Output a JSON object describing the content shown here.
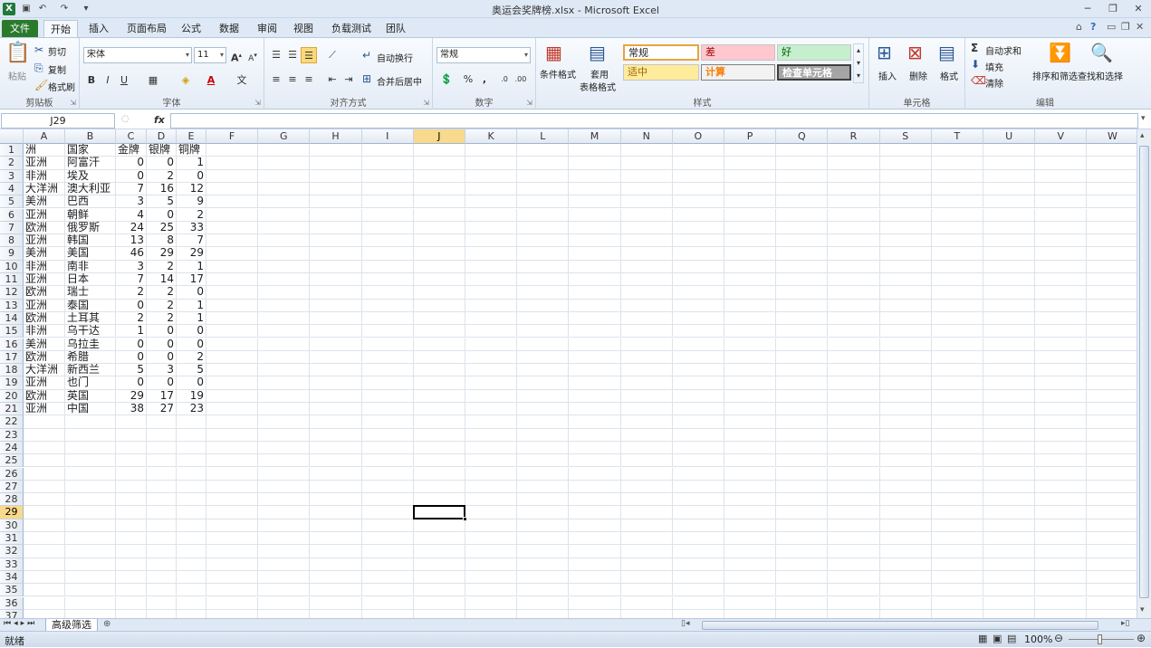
{
  "window": {
    "title": "奥运会奖牌榜.xlsx - Microsoft Excel"
  },
  "tabs": [
    "文件",
    "开始",
    "插入",
    "页面布局",
    "公式",
    "数据",
    "审阅",
    "视图",
    "负载测试",
    "团队"
  ],
  "ribbon": {
    "clipboard": {
      "paste": "粘贴",
      "cut": "剪切",
      "copy": "复制",
      "format_painter": "格式刷",
      "label": "剪贴板"
    },
    "font": {
      "name": "宋体",
      "size": "11",
      "label": "字体"
    },
    "alignment": {
      "wrap": "自动换行",
      "merge": "合并后居中",
      "label": "对齐方式"
    },
    "number": {
      "format": "常规",
      "label": "数字"
    },
    "styles": {
      "conditional": "条件格式",
      "table_l1": "套用",
      "table_l2": "表格格式",
      "normal": "常规",
      "bad": "差",
      "good": "好",
      "neutral": "适中",
      "calc": "计算",
      "check": "检查单元格",
      "label": "样式"
    },
    "cells": {
      "insert": "插入",
      "delete": "删除",
      "format": "格式",
      "label": "单元格"
    },
    "editing": {
      "autosum": "自动求和",
      "fill": "填充",
      "clear": "清除",
      "sort": "排序和筛选",
      "find": "查找和选择",
      "label": "编辑"
    }
  },
  "formula_bar": {
    "name_box": "J29",
    "fx": "fx",
    "formula": ""
  },
  "columns": [
    "A",
    "B",
    "C",
    "D",
    "E",
    "F",
    "G",
    "H",
    "I",
    "J",
    "K",
    "L",
    "M",
    "N",
    "O",
    "P",
    "Q",
    "R",
    "S",
    "T",
    "U",
    "V",
    "W"
  ],
  "selected_column": "J",
  "selected_row": 29,
  "row_count": 37,
  "sheet": {
    "headers": [
      "洲",
      "国家",
      "金牌",
      "银牌",
      "铜牌"
    ],
    "rows": [
      [
        "亚洲",
        "阿富汗",
        "0",
        "0",
        "1"
      ],
      [
        "非洲",
        "埃及",
        "0",
        "2",
        "0"
      ],
      [
        "大洋洲",
        "澳大利亚",
        "7",
        "16",
        "12"
      ],
      [
        "美洲",
        "巴西",
        "3",
        "5",
        "9"
      ],
      [
        "亚洲",
        "朝鲜",
        "4",
        "0",
        "2"
      ],
      [
        "欧洲",
        "俄罗斯",
        "24",
        "25",
        "33"
      ],
      [
        "亚洲",
        "韩国",
        "13",
        "8",
        "7"
      ],
      [
        "美洲",
        "美国",
        "46",
        "29",
        "29"
      ],
      [
        "非洲",
        "南非",
        "3",
        "2",
        "1"
      ],
      [
        "亚洲",
        "日本",
        "7",
        "14",
        "17"
      ],
      [
        "欧洲",
        "瑞士",
        "2",
        "2",
        "0"
      ],
      [
        "亚洲",
        "泰国",
        "0",
        "2",
        "1"
      ],
      [
        "欧洲",
        "土耳其",
        "2",
        "2",
        "1"
      ],
      [
        "非洲",
        "乌干达",
        "1",
        "0",
        "0"
      ],
      [
        "美洲",
        "乌拉圭",
        "0",
        "0",
        "0"
      ],
      [
        "欧洲",
        "希腊",
        "0",
        "0",
        "2"
      ],
      [
        "大洋洲",
        "新西兰",
        "5",
        "3",
        "5"
      ],
      [
        "亚洲",
        "也门",
        "0",
        "0",
        "0"
      ],
      [
        "欧洲",
        "英国",
        "29",
        "17",
        "19"
      ],
      [
        "亚洲",
        "中国",
        "38",
        "27",
        "23"
      ]
    ]
  },
  "sheet_tabs": [
    "高级筛选"
  ],
  "status": {
    "ready": "就绪",
    "zoom": "100%"
  }
}
